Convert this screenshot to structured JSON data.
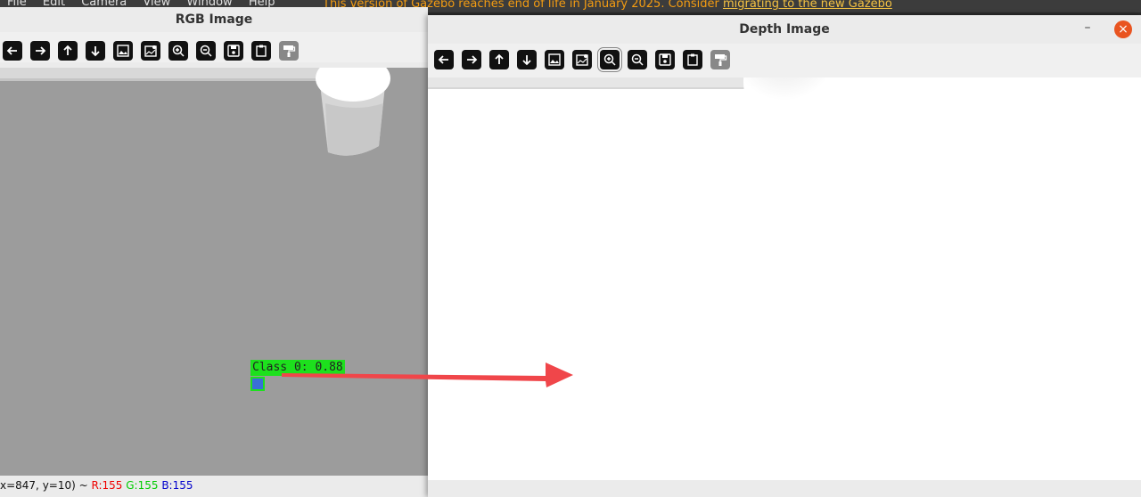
{
  "gazebo": {
    "menu": [
      "File",
      "Edit",
      "Camera",
      "View",
      "Window",
      "Help"
    ],
    "notice_prefix": "This version of Gazebo reaches end of life in January 2025. Consider ",
    "notice_link": "migrating to the new Gazebo"
  },
  "rgb_window": {
    "title": "RGB Image",
    "detection_label": "Class 0: 0.88",
    "status": {
      "coords": "x=847, y=10) ~",
      "r": "R:155",
      "g": "G:155",
      "b": "B:155"
    }
  },
  "depth_window": {
    "title": "Depth Image",
    "minimize": "–",
    "close": "×"
  },
  "toolbar_icons": [
    "arrow-left-icon",
    "arrow-right-icon",
    "arrow-up-icon",
    "arrow-down-icon",
    "image-icon",
    "image-settings-icon",
    "zoom-in-icon",
    "zoom-out-icon",
    "save-icon",
    "clipboard-icon",
    "paint-roller-icon"
  ],
  "colors": {
    "detection": "#1de01d",
    "arrow": "#f0464a",
    "close_button": "#e95420"
  }
}
